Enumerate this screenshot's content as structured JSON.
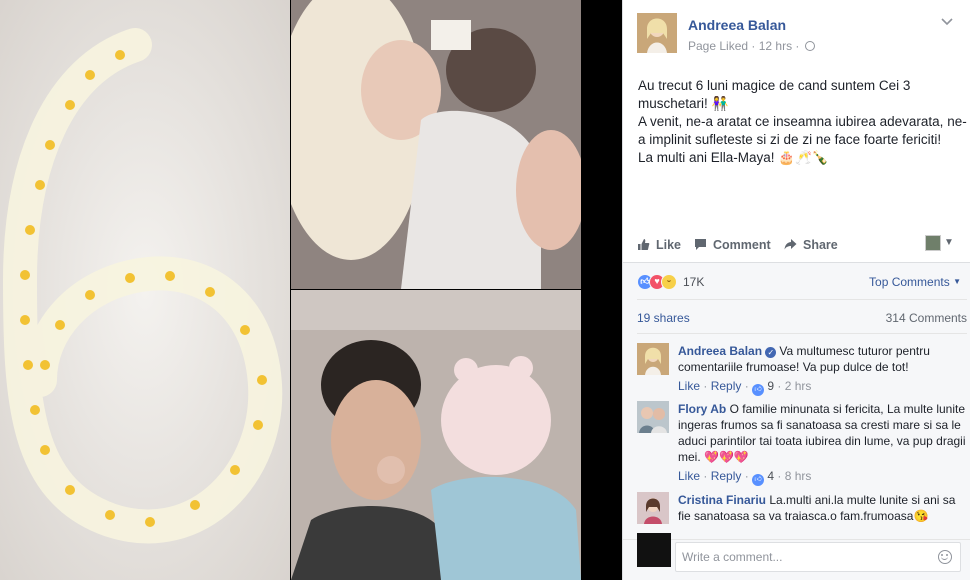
{
  "post": {
    "page_name": "Andreea Balan",
    "liked_status": "Page Liked",
    "time": "12 hrs",
    "separator": " · ",
    "text_lines": [
      "Au trecut 6 luni magice de cand suntem Cei 3 muschetari! 👫",
      "A venit, ne-a aratat ce inseamna iubirea adevarata, ne-a implinit sufleteste si zi de zi ne face foarte fericiti!",
      "La multi ani Ella-Maya! 🎂🥂🍾"
    ]
  },
  "actions": {
    "like": "Like",
    "comment": "Comment",
    "share": "Share"
  },
  "reactions": {
    "count": "17K",
    "sort_label": "Top Comments",
    "shares": "19 shares",
    "comments": "314 Comments",
    "icons": [
      "like-reaction",
      "love-reaction",
      "haha-reaction"
    ]
  },
  "comments": [
    {
      "author": "Andreea Balan",
      "verified": true,
      "text": "Va multumesc tuturor pentru comentariile frumoase! Va pup dulce de tot!",
      "like": "Like",
      "reply": "Reply",
      "likes": "9",
      "time": "2 hrs"
    },
    {
      "author": "Flory Ab",
      "verified": false,
      "text": "O familie minunata si fericita, La multe lunite ingeras frumos sa fi sanatoasa sa cresti mare si sa le aduci parintilor tai toata iubirea din lume, va pup dragii mei. 💖💖💖",
      "like": "Like",
      "reply": "Reply",
      "likes": "4",
      "time": "8 hrs"
    },
    {
      "author": "Cristina Finariu",
      "verified": false,
      "text": "La.multi ani.la multe lunite si ani sa fie sanatoasa sa va traiasca.o fam.frumoasa😘"
    }
  ],
  "composer": {
    "placeholder": "Write a comment..."
  },
  "colors": {
    "link": "#365899",
    "muted": "#90949c",
    "panel_bg": "#f6f7f9"
  }
}
